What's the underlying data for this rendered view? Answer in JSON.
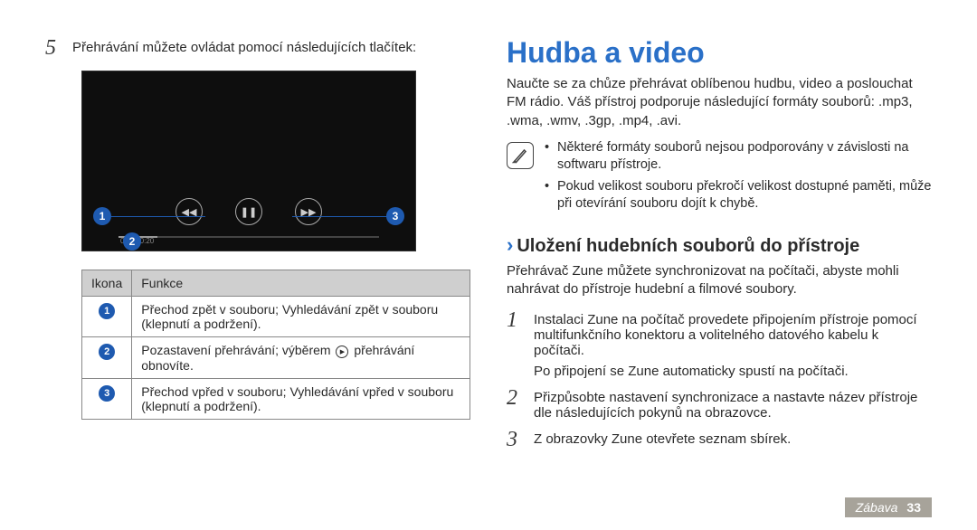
{
  "left": {
    "step5": "Přehrávání můžete ovládat pomocí následujících tlačítek:",
    "time": "0:11  /  0:20",
    "table": {
      "headers": [
        "Ikona",
        "Funkce"
      ],
      "rows": [
        {
          "num": "1",
          "text": "Přechod zpět v souboru; Vyhledávání zpět v souboru (klepnutí a podržení)."
        },
        {
          "num": "2",
          "text_a": "Pozastavení přehrávání; výběrem ",
          "text_b": " přehrávání obnovíte."
        },
        {
          "num": "3",
          "text": "Přechod vpřed v souboru; Vyhledávání vpřed v souboru (klepnutí a podržení)."
        }
      ]
    }
  },
  "right": {
    "heading": "Hudba a video",
    "intro": "Naučte se za chůze přehrávat oblíbenou hudbu, video a poslouchat FM rádio. Váš přístroj podporuje následující formáty souborů: .mp3, .wma, .wmv, .3gp, .mp4, .avi.",
    "notes": [
      "Některé formáty souborů nejsou podporovány v závislosti na softwaru přístroje.",
      "Pokud velikost souboru překročí velikost dostupné paměti, může při otevírání souboru dojít k chybě."
    ],
    "sub": "Uložení hudebních souborů do přístroje",
    "sub_intro": "Přehrávač Zune můžete synchronizovat na počítači, abyste mohli nahrávat do přístroje hudební a filmové soubory.",
    "steps": [
      "Instalaci Zune na počítač provedete připojením přístroje pomocí multifunkčního konektoru a volitelného datového kabelu k počítači.",
      "Přizpůsobte nastavení synchronizace a nastavte název přístroje dle následujících pokynů na obrazovce.",
      "Z obrazovky Zune otevřete seznam sbírek."
    ],
    "step1_after": "Po připojení se Zune automaticky spustí na počítači."
  },
  "footer": {
    "section": "Zábava",
    "page": "33"
  }
}
